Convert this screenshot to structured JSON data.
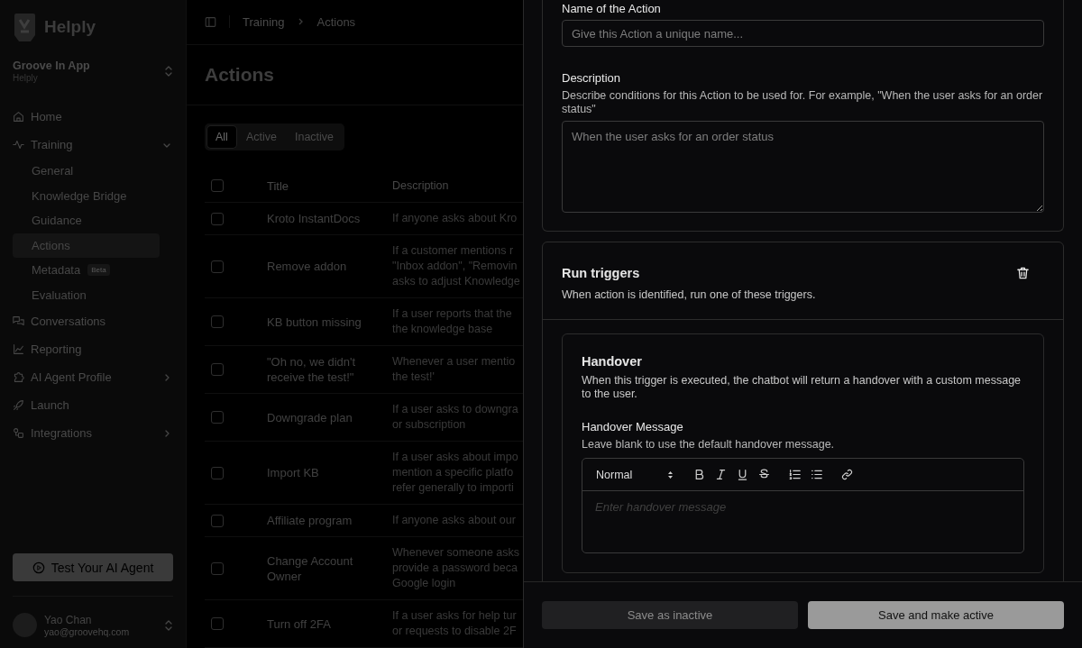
{
  "sidebar": {
    "brand": "Helply",
    "workspace": {
      "name": "Groove In App",
      "subtitle": "Helply"
    },
    "nav": [
      {
        "label": "Home",
        "kind": "link"
      },
      {
        "label": "Training",
        "kind": "group",
        "expanded": true,
        "children": [
          {
            "label": "General",
            "selected": false
          },
          {
            "label": "Knowledge Bridge",
            "selected": false
          },
          {
            "label": "Guidance",
            "selected": false
          },
          {
            "label": "Actions",
            "selected": true
          },
          {
            "label": "Metadata",
            "selected": false,
            "badge": "Beta"
          },
          {
            "label": "Evaluation",
            "selected": false
          }
        ]
      },
      {
        "label": "Conversations",
        "kind": "link"
      },
      {
        "label": "Reporting",
        "kind": "link"
      },
      {
        "label": "AI Agent Profile",
        "kind": "group",
        "expanded": false
      },
      {
        "label": "Launch",
        "kind": "link"
      },
      {
        "label": "Integrations",
        "kind": "group",
        "expanded": false
      }
    ],
    "test_button": "Test Your AI Agent",
    "user": {
      "name": "Yao Chan",
      "email": "yao@groovehq.com"
    }
  },
  "breadcrumb": [
    "Training",
    "Actions"
  ],
  "page_title": "Actions",
  "filter_tabs": [
    {
      "label": "All",
      "selected": true
    },
    {
      "label": "Active",
      "selected": false
    },
    {
      "label": "Inactive",
      "selected": false
    }
  ],
  "table": {
    "columns": [
      "Title",
      "Description"
    ],
    "all_checked": false,
    "rows": [
      {
        "title": "Kroto InstantDocs",
        "description": "If anyone asks about Kro",
        "checked": false
      },
      {
        "title": "Remove addon",
        "description": "If a customer mentions r\n\"Inbox addon\", \"Removin\nasks to adjust Knowledge",
        "checked": false
      },
      {
        "title": "KB button missing",
        "description": "If a user reports that the\nthe knowledge base",
        "checked": false
      },
      {
        "title": "\"Oh no, we didn't\nreceive the test!\"",
        "description": "Whenever a user mentio\nthe test!'",
        "checked": false
      },
      {
        "title": "Downgrade plan",
        "description": "If a user asks to downgra\nor subscription",
        "checked": false
      },
      {
        "title": "Import KB",
        "description": "If a user asks about impo\nmention a specific platfo\nrefer generally to importi",
        "checked": false
      },
      {
        "title": "Affiliate program",
        "description": "If anyone asks about our",
        "checked": false
      },
      {
        "title": "Change Account\nOwner",
        "description": "Whenever someone asks\nprovide a password beca\nGoogle login",
        "checked": false
      },
      {
        "title": "Turn off 2FA",
        "description": "If a user asks for help tur\nor requests to disable 2F",
        "checked": false
      }
    ]
  },
  "action_card": {
    "name_label": "Name of the Action",
    "name_placeholder": "Give this Action a unique name...",
    "description_label": "Description",
    "description_help": "Describe conditions for this Action to be used for. For example, \"When the user asks for an order status\"",
    "description_placeholder": "When the user asks for an order status"
  },
  "triggers_card": {
    "title": "Run triggers",
    "subtitle": "When action is identified, run one of these triggers.",
    "trigger": {
      "title": "Handover",
      "description": "When this trigger is executed, the chatbot will return a handover with a custom message to the user.",
      "message_label": "Handover Message",
      "message_help": "Leave blank to use the default handover message.",
      "format": "Normal",
      "placeholder": "Enter handover message"
    }
  },
  "footer_buttons": [
    {
      "label": "Save as inactive",
      "kind": "secondary"
    },
    {
      "label": "Save and make active",
      "kind": "primary"
    }
  ]
}
